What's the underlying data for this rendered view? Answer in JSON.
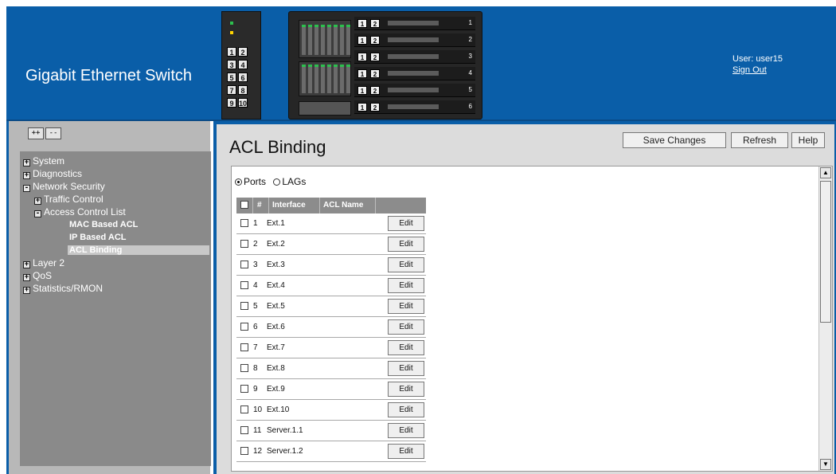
{
  "header": {
    "title": "Gigabit Ethernet Switch",
    "user_label": "User: user15",
    "sign_out": "Sign Out",
    "chassis_left_bays": [
      "1",
      "2",
      "3",
      "4",
      "5",
      "6",
      "7",
      "8",
      "9",
      "10"
    ],
    "server_slots": [
      {
        "tags": [
          "1",
          "2"
        ],
        "num": "1"
      },
      {
        "tags": [
          "1",
          "2"
        ],
        "num": "2"
      },
      {
        "tags": [
          "1",
          "2"
        ],
        "num": "3"
      },
      {
        "tags": [
          "1",
          "2"
        ],
        "num": "4"
      },
      {
        "tags": [
          "1",
          "2"
        ],
        "num": "5"
      },
      {
        "tags": [
          "1",
          "2"
        ],
        "num": "6"
      }
    ]
  },
  "sidebar": {
    "expand_all": "++",
    "collapse_all": "--",
    "items": [
      {
        "label": "System",
        "pm": "+"
      },
      {
        "label": "Diagnostics",
        "pm": "+"
      },
      {
        "label": "Network Security",
        "pm": "-"
      },
      {
        "label": "Traffic Control",
        "pm": "+"
      },
      {
        "label": "Access Control List",
        "pm": "-"
      },
      {
        "label": "MAC Based ACL"
      },
      {
        "label": "IP Based ACL"
      },
      {
        "label": "ACL Binding"
      },
      {
        "label": "Layer 2",
        "pm": "+"
      },
      {
        "label": "QoS",
        "pm": "+"
      },
      {
        "label": "Statistics/RMON",
        "pm": "+"
      }
    ]
  },
  "main": {
    "title": "ACL Binding",
    "save_changes": "Save Changes",
    "refresh": "Refresh",
    "help": "Help",
    "radio_ports": "Ports",
    "radio_lags": "LAGs",
    "table": {
      "col_num": "#",
      "col_interface": "Interface",
      "col_acl_name": "ACL Name",
      "edit_label": "Edit",
      "rows": [
        {
          "num": "1",
          "interface": "Ext.1"
        },
        {
          "num": "2",
          "interface": "Ext.2"
        },
        {
          "num": "3",
          "interface": "Ext.3"
        },
        {
          "num": "4",
          "interface": "Ext.4"
        },
        {
          "num": "5",
          "interface": "Ext.5"
        },
        {
          "num": "6",
          "interface": "Ext.6"
        },
        {
          "num": "7",
          "interface": "Ext.7"
        },
        {
          "num": "8",
          "interface": "Ext.8"
        },
        {
          "num": "9",
          "interface": "Ext.9"
        },
        {
          "num": "10",
          "interface": "Ext.10"
        },
        {
          "num": "11",
          "interface": "Server.1.1"
        },
        {
          "num": "12",
          "interface": "Server.1.2"
        }
      ]
    }
  },
  "colors": {
    "brand_blue": "#0a5ea8",
    "sidebar_gray": "#8a8a8a",
    "table_header_gray": "#8c8c8c"
  }
}
